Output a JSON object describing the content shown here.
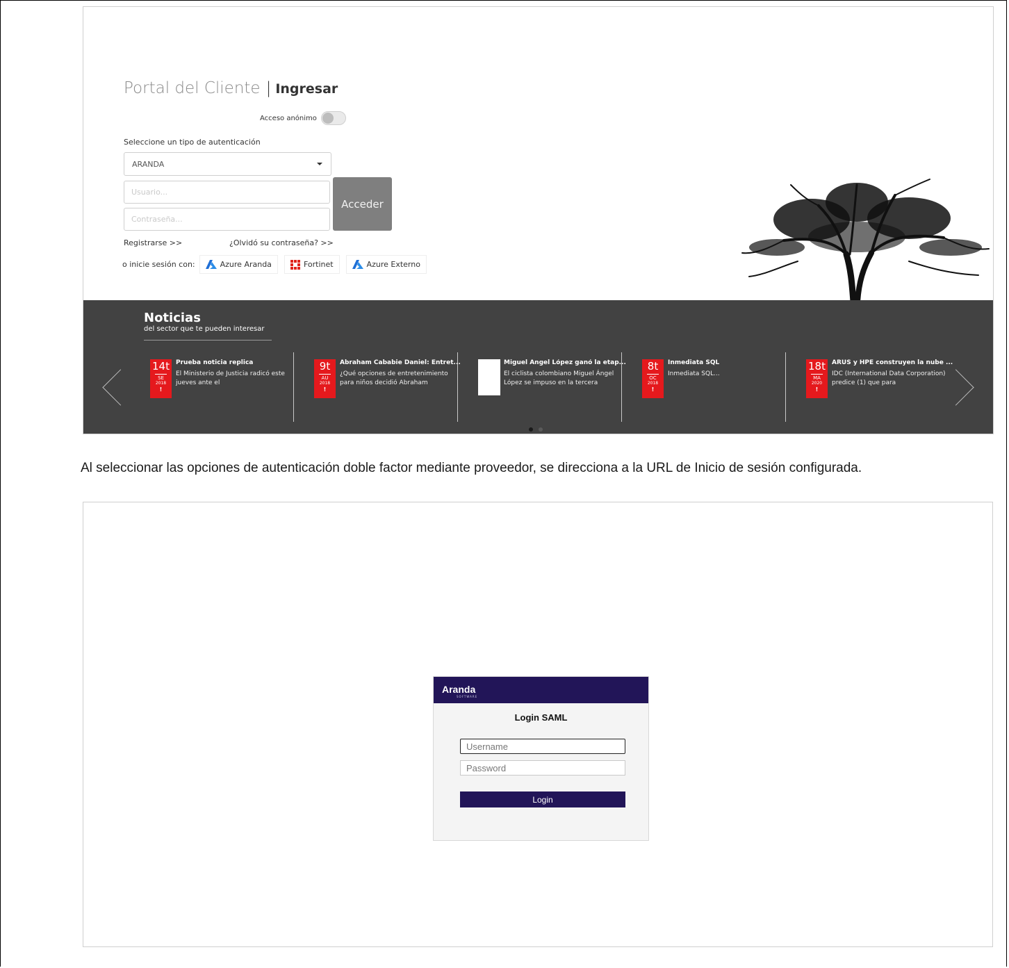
{
  "portal": {
    "title": "Portal del Cliente",
    "separator": "|",
    "ingresar": "Ingresar",
    "anon_label": "Acceso anónimo",
    "auth_label": "Seleccione un tipo de autenticación",
    "auth_selected": "ARANDA",
    "username_placeholder": "Usuario...",
    "password_placeholder": "Contraseña...",
    "acceder_label": "Acceder",
    "register_link": "Registrarse >>",
    "forgot_link": "¿Olvidó su contraseña? >>",
    "sso_prefix": "o inicie sesión con:",
    "sso_buttons": [
      {
        "label": "Azure Aranda",
        "icon": "azure-icon"
      },
      {
        "label": "Fortinet",
        "icon": "fortinet-icon"
      },
      {
        "label": "Azure Externo",
        "icon": "azure-icon"
      }
    ]
  },
  "news": {
    "title": "Noticias",
    "subtitle": "del sector que te pueden interesar",
    "items": [
      {
        "day": "14t",
        "month": "SE",
        "year": "2018",
        "mark": "!",
        "headline": "Prueba noticia replica",
        "body": "El Ministerio de Justicia radicó este jueves ante el"
      },
      {
        "day": "9t",
        "month": "AU",
        "year": "2018",
        "mark": "!",
        "headline": "Abraham Cababie Daniel: Entret...",
        "body": "¿Qué opciones de entretenimiento para niños decidió Abraham"
      },
      {
        "day": "",
        "month": "",
        "year": "",
        "mark": "",
        "headline": "Miguel Ángel López ganó la etap...",
        "body": "El ciclista colombiano Miguel Ángel López se impuso en la tercera"
      },
      {
        "day": "8t",
        "month": "OC",
        "year": "2018",
        "mark": "!",
        "headline": "Inmediata SQL",
        "body": "Inmediata SQL..."
      },
      {
        "day": "18t",
        "month": "MA",
        "year": "2020",
        "mark": "!",
        "headline": "ARUS y HPE construyen la nube ...",
        "body": "IDC (International Data Corporation) predice (1) que para"
      }
    ]
  },
  "paragraph": "Al seleccionar las opciones de autenticación doble factor mediante proveedor, se direcciona a la URL de Inicio de sesión configurada.",
  "saml": {
    "logo": "Aranda",
    "logo_sub": "SOFTWARE",
    "title": "Login SAML",
    "username_placeholder": "Username",
    "password_placeholder": "Password",
    "login_label": "Login"
  },
  "colors": {
    "badge_red": "#e5191d",
    "news_bg": "#424242",
    "saml_brand": "#221558",
    "acceder_bg": "#7f7f7f"
  }
}
